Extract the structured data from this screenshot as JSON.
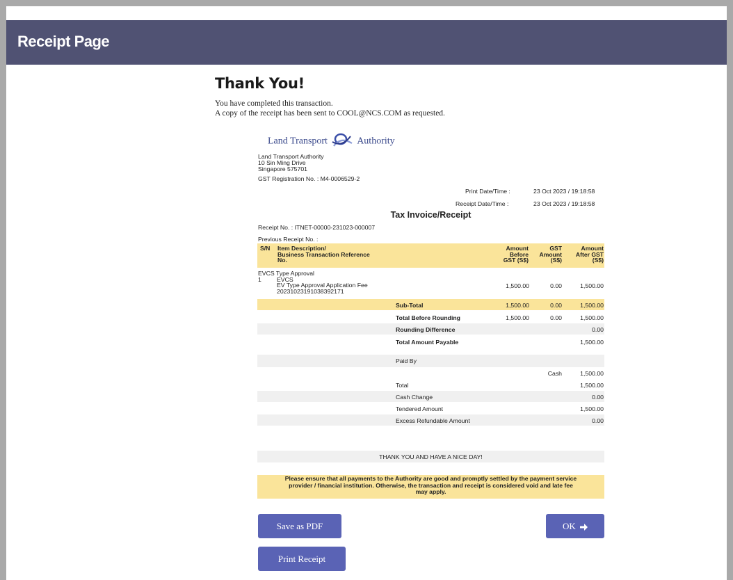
{
  "page": {
    "title": "Receipt Page"
  },
  "thanks": {
    "heading": "Thank You!",
    "line1": "You have completed this transaction.",
    "line2": "A copy of the receipt has been sent to COOL@NCS.COM as requested."
  },
  "receipt": {
    "logo_left": "Land Transport",
    "logo_right": "Authority",
    "org_name": "Land Transport Authority",
    "addr1": "10 Sin Ming Drive",
    "addr2": "Singapore 575701",
    "gst_reg": "GST Registration No. : M4-0006529-2",
    "print_label": "Print Date/Time :",
    "print_value": "23 Oct 2023 / 19:18:58",
    "receipt_label": "Receipt Date/Time :",
    "receipt_value": "23 Oct 2023 / 19:18:58",
    "title": "Tax Invoice/Receipt",
    "receipt_no": "Receipt No. : ITNET-00000-231023-000007",
    "prev_receipt": "Previous Receipt No. :",
    "columns": {
      "sn": "S/N",
      "desc1": "Item Description/",
      "desc2": "Business Transaction Reference",
      "desc3": "No.",
      "amt1": "Amount",
      "amt2": "Before",
      "amt3": "GST (S$)",
      "gst1": "GST",
      "gst2": "Amount",
      "gst3": "(S$)",
      "aft1": "Amount",
      "aft2": "After GST",
      "aft3": "(S$)"
    },
    "item": {
      "group": "EVCS Type Approval",
      "sn": "1",
      "name": "EVCS",
      "desc": "EV Type Approval Application Fee",
      "ref": "20231023191038392171",
      "before": "1,500.00",
      "gst": "0.00",
      "after": "1,500.00"
    },
    "summary": [
      {
        "label": "Sub-Total",
        "before": "1,500.00",
        "gst": "0.00",
        "after": "1,500.00"
      },
      {
        "label": "Total Before Rounding",
        "before": "1,500.00",
        "gst": "0.00",
        "after": "1,500.00"
      },
      {
        "label": "Rounding Difference",
        "before": "",
        "gst": "",
        "after": "0.00"
      },
      {
        "label": "Total Amount Payable",
        "before": "",
        "gst": "",
        "after": "1,500.00"
      }
    ],
    "paid_by": "Paid By",
    "payment_method": "Cash",
    "payment_amount": "1,500.00",
    "totals": [
      {
        "label": "Total",
        "value": "1,500.00"
      },
      {
        "label": "Cash Change",
        "value": "0.00"
      },
      {
        "label": "Tendered Amount",
        "value": "1,500.00"
      },
      {
        "label": "Excess Refundable Amount",
        "value": "0.00"
      }
    ],
    "closing": "THANK YOU AND HAVE A NICE DAY!"
  },
  "notice": {
    "line1": "Please ensure that all payments to the Authority are good and promptly settled by the payment service",
    "line2": "provider / financial institution. Otherwise, the transaction and receipt is considered void and late fee",
    "line3": "may apply."
  },
  "buttons": {
    "save_pdf": "Save as PDF",
    "ok": "OK",
    "print": "Print Receipt"
  },
  "colors": {
    "header_bg": "#505273",
    "highlight": "#fae49a",
    "button": "#5a63b5",
    "stripe": "#f0f0f0"
  }
}
